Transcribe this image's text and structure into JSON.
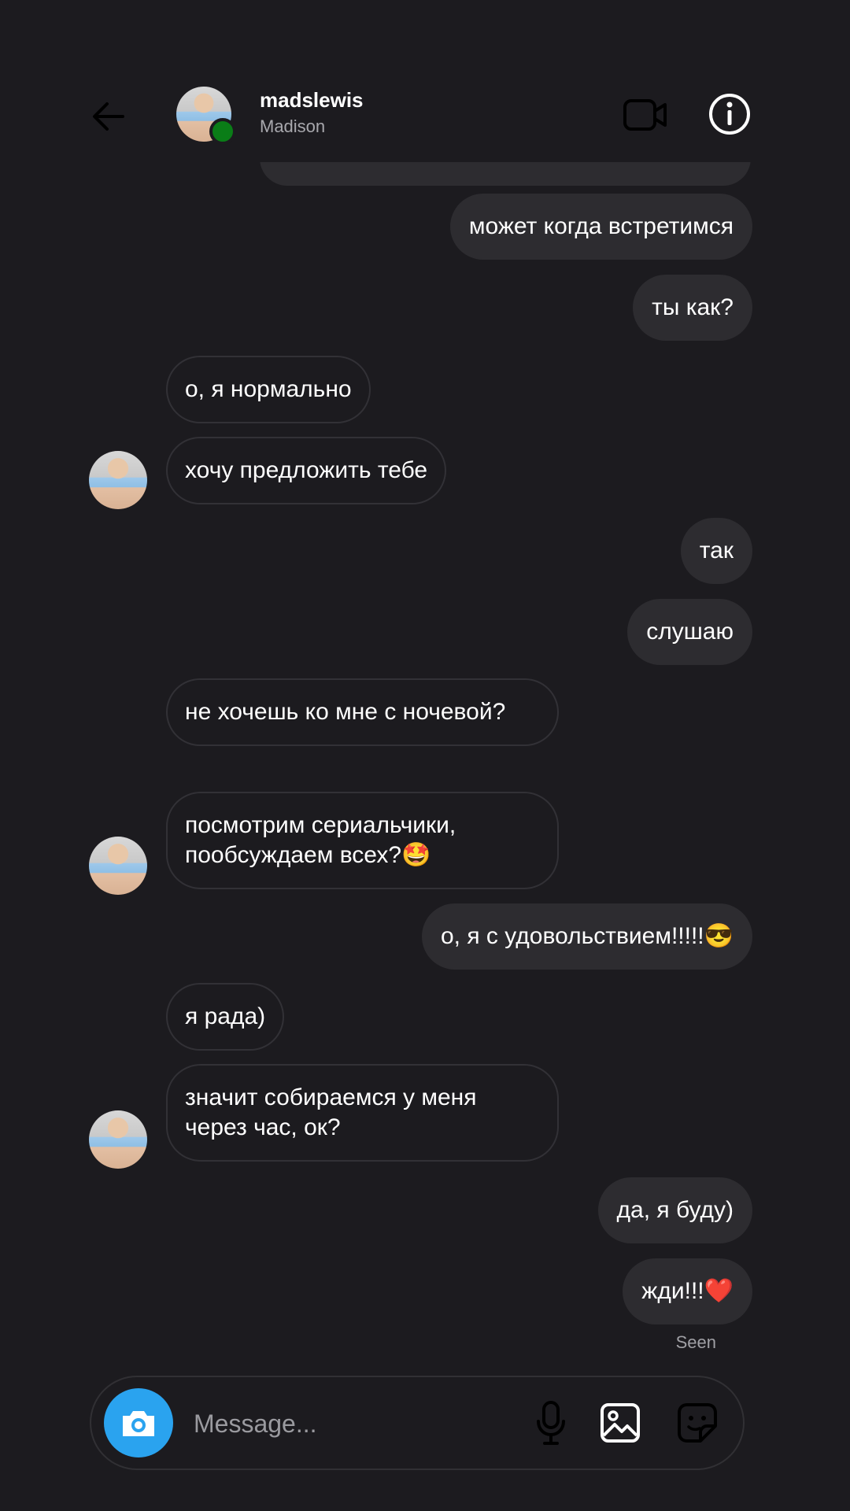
{
  "header": {
    "username": "madslewis",
    "display_name": "Madison",
    "online": true
  },
  "messages": [
    {
      "text": "может когда встретимся",
      "from": "me"
    },
    {
      "text": "ты как?",
      "from": "me"
    },
    {
      "text": "о, я нормально",
      "from": "them"
    },
    {
      "text": "хочу предложить тебе",
      "from": "them"
    },
    {
      "text": "так",
      "from": "me"
    },
    {
      "text": "слушаю",
      "from": "me"
    },
    {
      "text": "не хочешь ко мне с ночевой?",
      "from": "them"
    },
    {
      "text": "посмотрим сериальчики, пообсуждаем всех?🤩",
      "from": "them"
    },
    {
      "text": "о, я с удовольствием!!!!!😎",
      "from": "me"
    },
    {
      "text": "я рада)",
      "from": "them"
    },
    {
      "text": "значит собираемся у меня через час, ок?",
      "from": "them"
    },
    {
      "text": "да, я буду)",
      "from": "me"
    },
    {
      "text": "жди!!!❤️",
      "from": "me"
    }
  ],
  "seen_label": "Seen",
  "composer": {
    "placeholder": "Message..."
  },
  "colors": {
    "background": "#1c1b1f",
    "sent_bubble": "#2d2c30",
    "received_border": "#323136",
    "camera_button": "#2aa3ef",
    "online": "#0a7d17"
  },
  "icons": [
    "back-arrow-icon",
    "video-call-icon",
    "info-icon",
    "camera-icon",
    "microphone-icon",
    "gallery-icon",
    "sticker-icon"
  ]
}
